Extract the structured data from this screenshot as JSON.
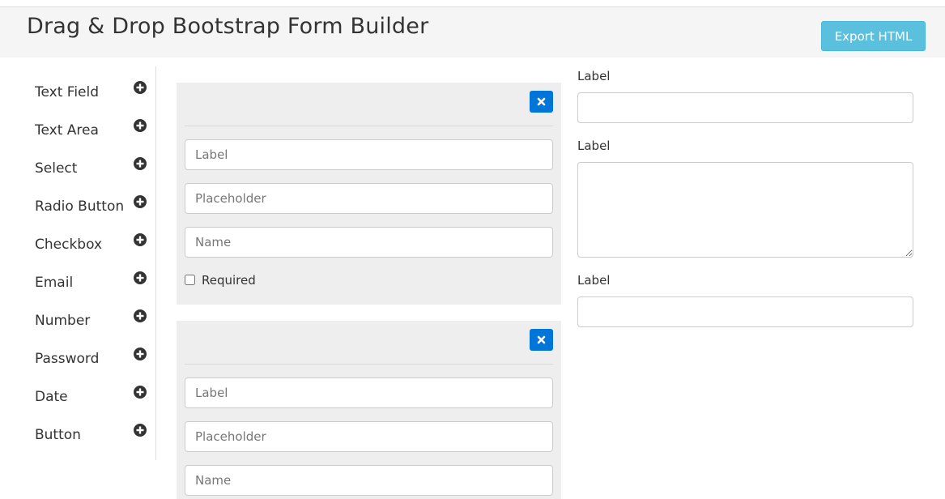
{
  "header": {
    "title": "Drag & Drop Bootstrap Form Builder",
    "export_label": "Export HTML"
  },
  "sidebar": {
    "items": [
      {
        "label": "Text Field",
        "icon": "plus-circle-icon"
      },
      {
        "label": "Text Area",
        "icon": "plus-circle-icon"
      },
      {
        "label": "Select",
        "icon": "plus-circle-icon"
      },
      {
        "label": "Radio Button",
        "icon": "plus-circle-icon"
      },
      {
        "label": "Checkbox",
        "icon": "plus-circle-icon"
      },
      {
        "label": "Email",
        "icon": "plus-circle-icon"
      },
      {
        "label": "Number",
        "icon": "plus-circle-icon"
      },
      {
        "label": "Password",
        "icon": "plus-circle-icon"
      },
      {
        "label": "Date",
        "icon": "plus-circle-icon"
      },
      {
        "label": "Button",
        "icon": "plus-circle-icon"
      }
    ]
  },
  "editor": {
    "panels": [
      {
        "label_placeholder": "Label",
        "placeholder_placeholder": "Placeholder",
        "name_placeholder": "Name",
        "required_label": "Required",
        "required_checked": false
      },
      {
        "label_placeholder": "Label",
        "placeholder_placeholder": "Placeholder",
        "name_placeholder": "Name"
      }
    ]
  },
  "preview": {
    "fields": [
      {
        "label": "Label",
        "type": "text"
      },
      {
        "label": "Label",
        "type": "textarea"
      },
      {
        "label": "Label",
        "type": "text"
      }
    ]
  },
  "colors": {
    "header_bg": "#f5f5f5",
    "export_button": "#5bc0de",
    "remove_button": "#0275d8",
    "panel_bg": "#eeeeee"
  }
}
